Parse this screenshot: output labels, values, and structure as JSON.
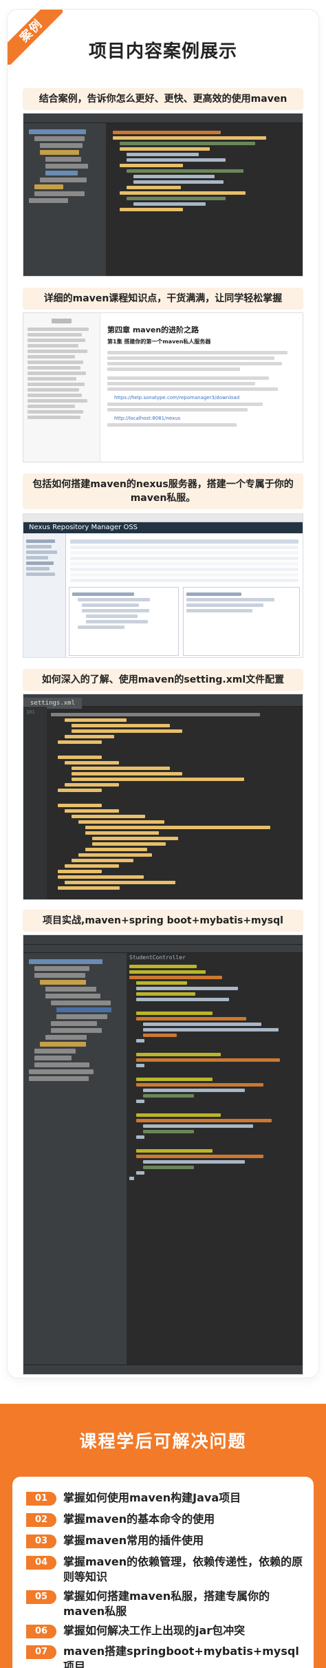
{
  "badge": "案例",
  "title": "项目内容案例展示",
  "sections": [
    {
      "caption": "结合案例，告诉你怎么更好、更快、更高效的使用maven"
    },
    {
      "caption": "详细的maven课程知识点，干货满满，让同学轻松掌握"
    },
    {
      "caption": "包括如何搭建maven的nexus服务器，搭建一个专属于你的maven私服。"
    },
    {
      "caption": "如何深入的了解、使用maven的setting.xml文件配置"
    },
    {
      "caption": "项目实战,maven+spring boot+mybatis+mysql"
    }
  ],
  "doc": {
    "chapter": "第四章 maven的进阶之路",
    "section": "第1集 搭建你的第一个maven私人服务器",
    "link1": "https://help.sonatype.com/repomanager3/download",
    "link2": "http://localhost:8081/nexus"
  },
  "nexus": {
    "title": "Nexus Repository Manager OSS"
  },
  "xml": {
    "tab": "settings.xml",
    "line_start": "101"
  },
  "ide": {
    "class_name": "StudentController"
  },
  "outcomes": {
    "title": "课程学后可解决问题",
    "items": [
      {
        "num": "01",
        "text": "掌握如何使用maven构建Java项目"
      },
      {
        "num": "02",
        "text": "掌握maven的基本命令的使用"
      },
      {
        "num": "03",
        "text": "掌握maven常用的插件使用"
      },
      {
        "num": "04",
        "text": "掌握maven的依赖管理，依赖传递性，依赖的原则等知识"
      },
      {
        "num": "05",
        "text": "掌握如何搭建maven私服，搭建专属你的maven私服"
      },
      {
        "num": "06",
        "text": "掌握如何解决工作上出现的jar包冲突"
      },
      {
        "num": "07",
        "text": "maven搭建springboot+mybatis+mysql项目"
      }
    ]
  },
  "colors": {
    "accent": "#f27a28",
    "caption_bg": "#fdf1e3",
    "ide_dark": "#2b2b2b"
  }
}
